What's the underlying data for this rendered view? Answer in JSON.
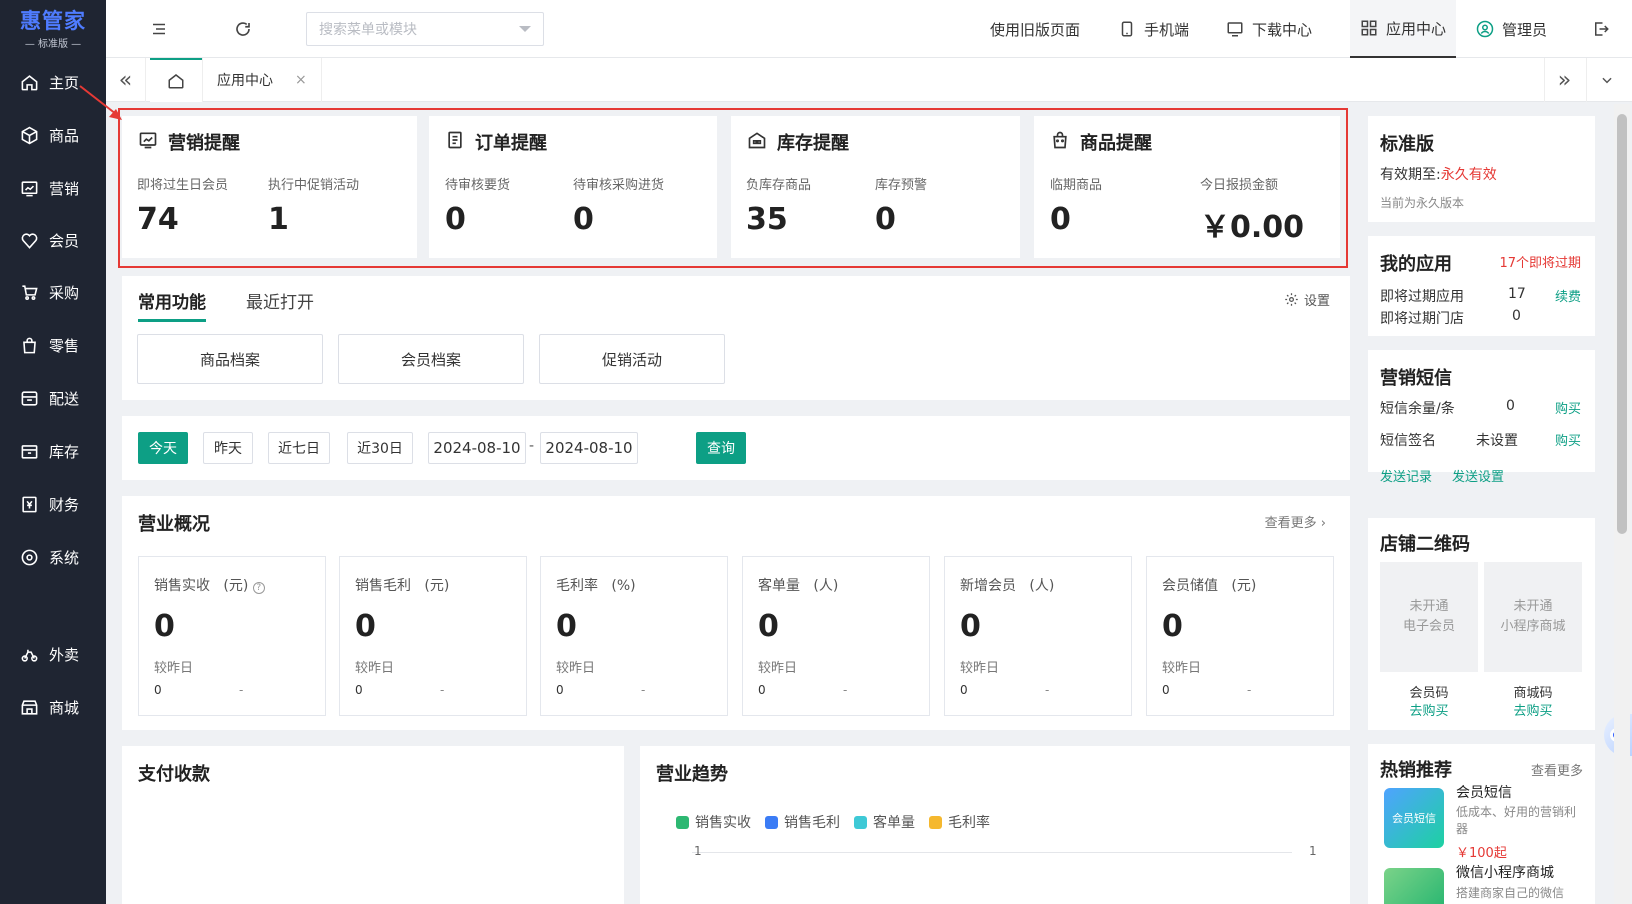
{
  "app": {
    "logo": "惠管家",
    "edition": "— 标准版 —"
  },
  "sidebar": {
    "items": [
      {
        "label": "主页",
        "icon": "home-icon"
      },
      {
        "label": "商品",
        "icon": "box-icon"
      },
      {
        "label": "营销",
        "icon": "chart-icon"
      },
      {
        "label": "会员",
        "icon": "heart-icon"
      },
      {
        "label": "采购",
        "icon": "cart-icon"
      },
      {
        "label": "零售",
        "icon": "bag-icon"
      },
      {
        "label": "配送",
        "icon": "truck-icon"
      },
      {
        "label": "库存",
        "icon": "inventory-icon"
      },
      {
        "label": "财务",
        "icon": "finance-icon"
      },
      {
        "label": "系统",
        "icon": "settings-icon"
      },
      {
        "label": "外卖",
        "icon": "scooter-icon"
      },
      {
        "label": "商城",
        "icon": "store-icon"
      }
    ]
  },
  "topbar": {
    "search_placeholder": "搜索菜单或模块",
    "old_page": "使用旧版页面",
    "mobile": "手机端",
    "download": "下载中心",
    "app_center": "应用中心",
    "admin": "管理员"
  },
  "tabs": {
    "active": "应用中心",
    "close": "×"
  },
  "reminders": [
    {
      "title": "营销提醒",
      "items": [
        {
          "label": "即将过生日会员",
          "value": "74"
        },
        {
          "label": "执行中促销活动",
          "value": "1"
        }
      ]
    },
    {
      "title": "订单提醒",
      "items": [
        {
          "label": "待审核要货",
          "value": "0"
        },
        {
          "label": "待审核采购进货",
          "value": "0"
        }
      ]
    },
    {
      "title": "库存提醒",
      "items": [
        {
          "label": "负库存商品",
          "value": "35"
        },
        {
          "label": "库存预警",
          "value": "0"
        }
      ]
    },
    {
      "title": "商品提醒",
      "items": [
        {
          "label": "临期商品",
          "value": "0"
        },
        {
          "label": "今日报损金额",
          "value": "￥0.00"
        }
      ]
    }
  ],
  "functions": {
    "tab_common": "常用功能",
    "tab_recent": "最近打开",
    "settings": "设置",
    "buttons": [
      "商品档案",
      "会员档案",
      "促销活动"
    ]
  },
  "date_filter": {
    "today": "今天",
    "yesterday": "昨天",
    "last7": "近七日",
    "last30": "近30日",
    "start": "2024-08-10",
    "sep": "-",
    "end": "2024-08-10",
    "query": "查询"
  },
  "overview": {
    "title": "营业概况",
    "more": "查看更多 ›",
    "compare_label": "较昨日",
    "kpis": [
      {
        "name": "销售实收",
        "unit": "(元)",
        "value": "0",
        "cmp": "0",
        "delta": "-"
      },
      {
        "name": "销售毛利",
        "unit": "(元)",
        "value": "0",
        "cmp": "0",
        "delta": "-"
      },
      {
        "name": "毛利率",
        "unit": "(%)",
        "value": "0",
        "cmp": "0",
        "delta": "-"
      },
      {
        "name": "客单量",
        "unit": "(人)",
        "value": "0",
        "cmp": "0",
        "delta": "-"
      },
      {
        "name": "新增会员",
        "unit": "(人)",
        "value": "0",
        "cmp": "0",
        "delta": "-"
      },
      {
        "name": "会员储值",
        "unit": "(元)",
        "value": "0",
        "cmp": "0",
        "delta": "-"
      }
    ]
  },
  "payment": {
    "title": "支付收款"
  },
  "trend": {
    "title": "营业趋势",
    "legend": [
      {
        "name": "销售实收",
        "color": "#2db872"
      },
      {
        "name": "销售毛利",
        "color": "#3b7cf5"
      },
      {
        "name": "客单量",
        "color": "#3ec9d6"
      },
      {
        "name": "毛利率",
        "color": "#f5b82e"
      }
    ],
    "y_left": "1",
    "y_right": "1"
  },
  "edition": {
    "title": "标准版",
    "valid_label": "有效期至:",
    "valid_value": "永久有效",
    "note": "当前为永久版本"
  },
  "my_apps": {
    "title": "我的应用",
    "expiring": "17个即将过期",
    "rows": [
      {
        "label": "即将过期应用",
        "value": "17",
        "action": "续费"
      },
      {
        "label": "即将过期门店",
        "value": "0",
        "action": ""
      }
    ]
  },
  "sms": {
    "title": "营销短信",
    "rows": [
      {
        "label": "短信余量/条",
        "value": "0",
        "action": "购买"
      },
      {
        "label": "短信签名",
        "value": "未设置",
        "action": "购买"
      }
    ],
    "links": [
      "发送记录",
      "发送设置"
    ]
  },
  "qrcode": {
    "title": "店铺二维码",
    "items": [
      {
        "status": "未开通",
        "kind": "电子会员",
        "label": "会员码",
        "action": "去购买"
      },
      {
        "status": "未开通",
        "kind": "小程序商城",
        "label": "商城码",
        "action": "去购买"
      }
    ]
  },
  "hot": {
    "title": "热销推荐",
    "more": "查看更多",
    "items": [
      {
        "name": "会员短信",
        "desc": "低成本、好用的营销利器",
        "price": "￥100起",
        "badge": "会员短信"
      },
      {
        "name": "微信小程序商城",
        "desc": "搭建商家自己的微信"
      }
    ]
  }
}
